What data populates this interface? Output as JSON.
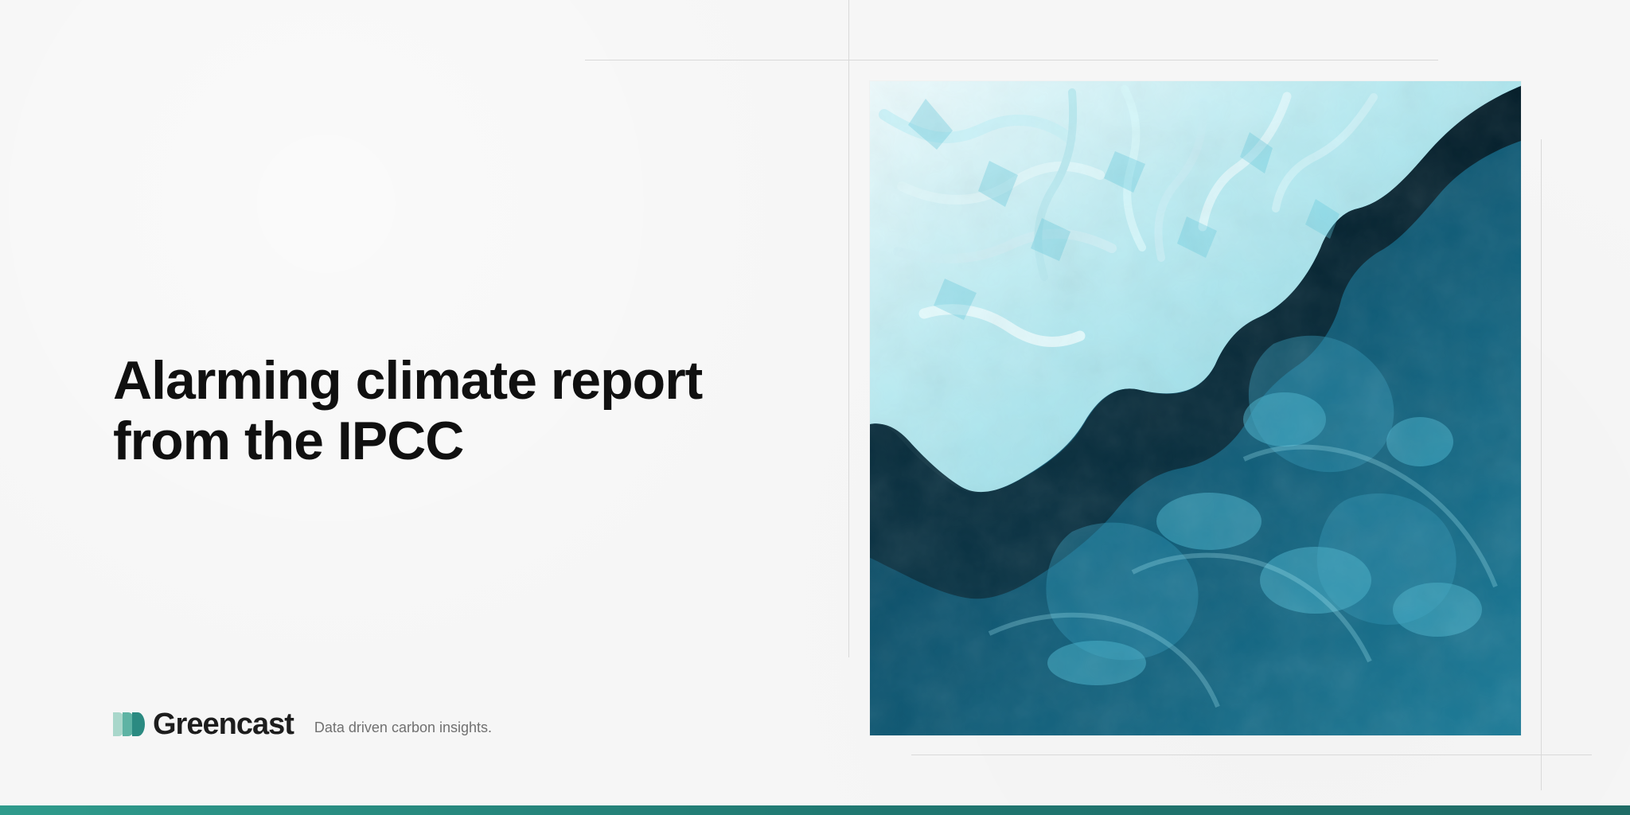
{
  "headline": {
    "line1": "Alarming climate report",
    "line2": "from the IPCC"
  },
  "brand": {
    "name": "Greencast",
    "tagline": "Data driven carbon insights."
  },
  "image": {
    "name": "satellite-ice-coastline-image",
    "alt": ""
  },
  "colors": {
    "background": "#f6f6f6",
    "headline": "#101010",
    "brand_text": "#1d1d1d",
    "tagline": "#707070",
    "logo_light": "#a9d7cb",
    "logo_mid": "#5eb3a4",
    "logo_dark": "#2b8a81",
    "footer_band": "#1f766f"
  },
  "icons": {
    "logo": "greencast-logo-icon"
  }
}
